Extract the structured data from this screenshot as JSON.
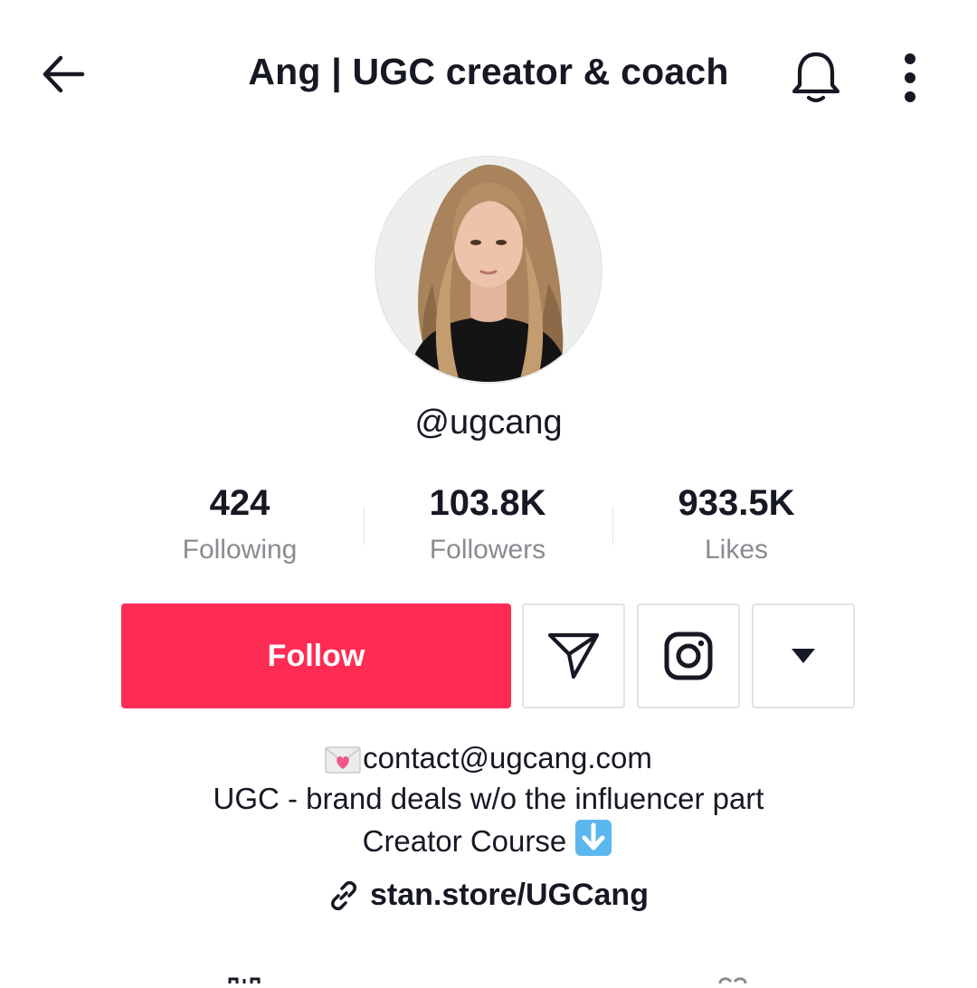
{
  "header": {
    "title": "Ang | UGC creator & coach",
    "icons": {
      "back": "arrow-left-icon",
      "bell": "bell-icon",
      "more": "vertical-dots-icon"
    }
  },
  "profile": {
    "username": "@ugcang"
  },
  "stats": {
    "following": {
      "value": "424",
      "label": "Following"
    },
    "followers": {
      "value": "103.8K",
      "label": "Followers"
    },
    "likes": {
      "value": "933.5K",
      "label": "Likes"
    }
  },
  "actions": {
    "follow_label": "Follow",
    "icons": {
      "message": "send-arrow-icon",
      "instagram": "instagram-icon",
      "dropdown": "caret-down-icon"
    }
  },
  "bio": {
    "email": "contact@ugcang.com",
    "line2": "UGC - brand deals w/o the influencer part",
    "line3": "Creator Course",
    "emojis": {
      "email_prefix": "love-letter-emoji",
      "line3_suffix": "down-arrow-emoji"
    }
  },
  "link": {
    "text": "stan.store/UGCang",
    "icon": "link-icon"
  },
  "colors": {
    "accent": "#fe2c55",
    "text": "#161823",
    "secondary": "#8a8b91",
    "border": "#e3e3e4"
  }
}
